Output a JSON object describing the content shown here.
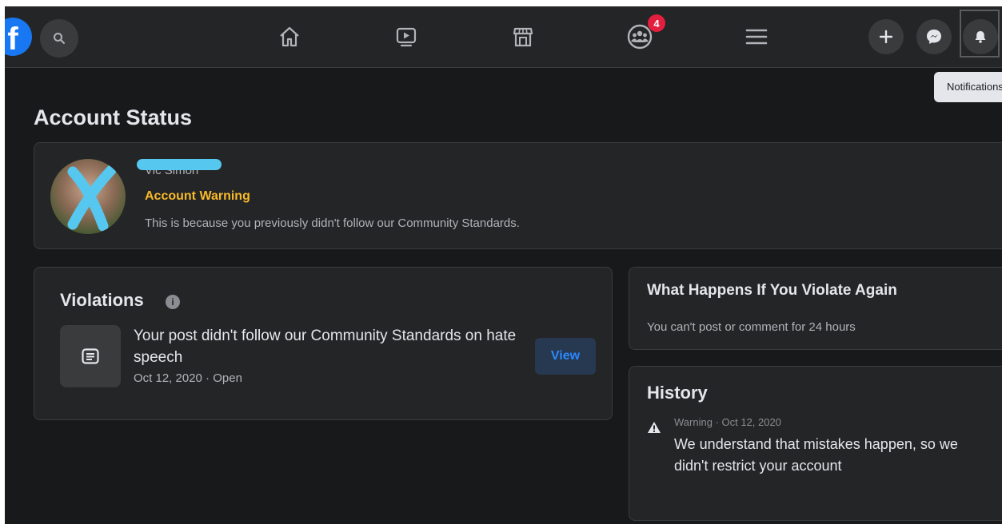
{
  "header": {
    "logo_text": "f",
    "search_icon": "search-icon",
    "nav_icons": [
      "home-icon",
      "watch-icon",
      "marketplace-icon",
      "groups-icon",
      "menu-icon"
    ],
    "groups_badge": "4",
    "right_icons": [
      "plus-icon",
      "messenger-icon",
      "bell-icon"
    ],
    "tooltip": "Notifications"
  },
  "page": {
    "title": "Account Status"
  },
  "status_card": {
    "name": "Vic Simon",
    "status": "Account Warning",
    "reason": "This is because you previously didn't follow our Community Standards."
  },
  "violations": {
    "title": "Violations",
    "info_glyph": "i",
    "item": {
      "title": "Your post didn't follow our Community Standards on hate speech",
      "meta": "Oct 12, 2020 · Open",
      "action_label": "View"
    }
  },
  "consequence": {
    "title": "What Happens If You Violate Again",
    "body": "You can't post or comment for 24 hours"
  },
  "history": {
    "title": "History",
    "entry": {
      "meta": "Warning · Oct 12, 2020",
      "body": "We understand that mistakes happen, so we didn't restrict your account"
    }
  },
  "colors": {
    "background": "#18191a",
    "card": "#242526",
    "brand": "#1877f2",
    "warning": "#f7b928",
    "badge": "#e41e3f",
    "link": "#2d88ff"
  }
}
